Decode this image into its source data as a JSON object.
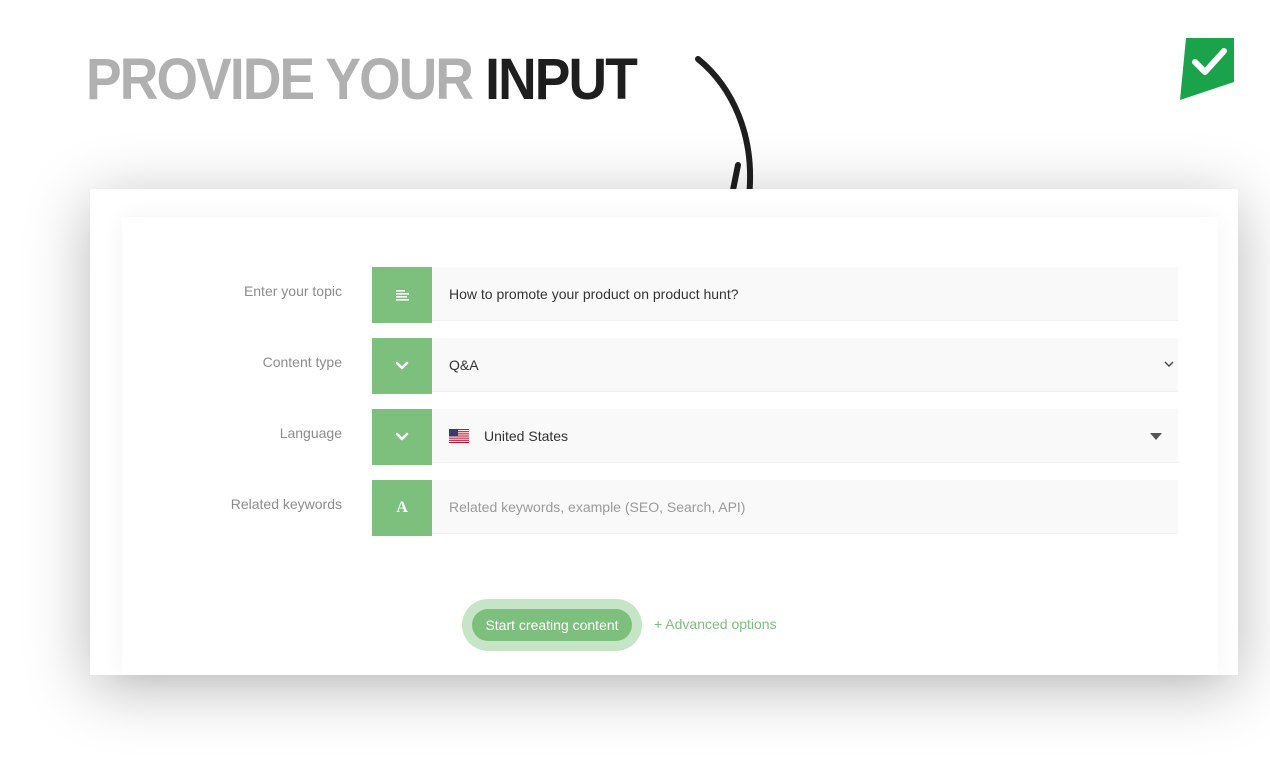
{
  "headline": {
    "muted": "PROVIDE YOUR",
    "strong": "INPUT"
  },
  "icons": {
    "arrow": "curved-arrow-icon",
    "brand": "green-checkmark-logo"
  },
  "colors": {
    "accent": "#7dc07d",
    "accent_light": "#c6e4c6",
    "headline_muted": "#b0b0b0",
    "headline_strong": "#1e1e1e",
    "label": "#8c8c8c",
    "field_bg": "#f9f9f9"
  },
  "form": {
    "topic": {
      "label": "Enter your topic",
      "value": "How to promote your product on product hunt?",
      "icon": "text-lines-icon"
    },
    "content_type": {
      "label": "Content type",
      "value": "Q&A",
      "icon": "chevron-down-icon"
    },
    "language": {
      "label": "Language",
      "value": "United States",
      "flag": "us-flag-icon",
      "icon": "chevron-down-icon"
    },
    "keywords": {
      "label": "Related keywords",
      "placeholder": "Related keywords, example (SEO, Search, API)",
      "icon": "letter-a-icon",
      "icon_text": "A"
    }
  },
  "actions": {
    "start_label": "Start creating content",
    "advanced_label": "+ Advanced options"
  }
}
